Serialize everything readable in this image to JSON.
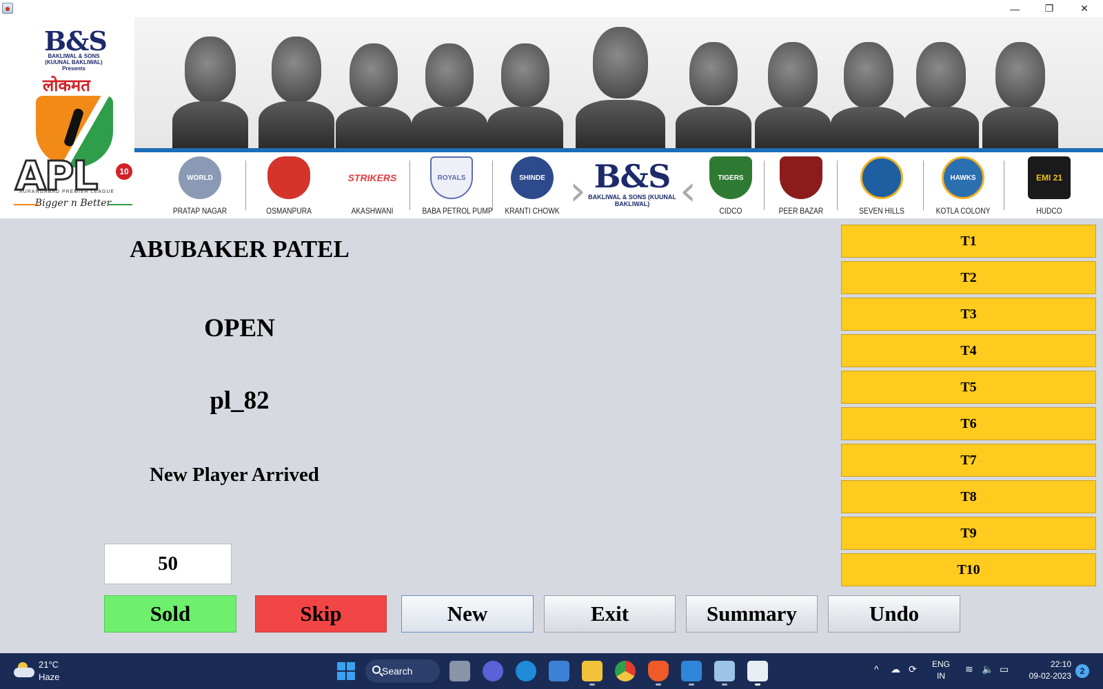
{
  "window": {
    "minimize_glyph": "—",
    "restore_glyph": "❐",
    "close_glyph": "✕"
  },
  "banner": {
    "sponsor_top": "B&S",
    "sponsor_top_sub": "BAKLIWAL & SONS (KUUNAL BAKLIWAL) Presents",
    "media_partner": "लोकमत",
    "league_short": "APL",
    "league_edition": "10",
    "league_full": "AURANGABAD PREMIER LEAGUE",
    "tagline": "Bigger n Better",
    "center_sponsor": "B&S",
    "center_sponsor_sub": "BAKLIWAL & SONS (KUUNAL BAKLIWAL)",
    "teams": [
      {
        "name": "PRATAP NAGAR",
        "logo_text": "WORLD",
        "color": "#8a9ab5"
      },
      {
        "name": "OSMANPURA",
        "logo_text": "",
        "color": "#d4342a"
      },
      {
        "name": "AKASHWANI",
        "logo_text": "STRIKERS",
        "color": "#e23b3b"
      },
      {
        "name": "BABA PETROL PUMP",
        "logo_text": "ROYALS",
        "color": "#5b6bb0"
      },
      {
        "name": "KRANTI CHOWK",
        "logo_text": "SHINDE",
        "color": "#2d4a8c"
      },
      {
        "name": "CIDCO",
        "logo_text": "TIGERS",
        "color": "#2e7a32"
      },
      {
        "name": "PEER BAZAR",
        "logo_text": "",
        "color": "#8c1c1c"
      },
      {
        "name": "SEVEN HILLS",
        "logo_text": "",
        "color": "#1d5fa0"
      },
      {
        "name": "KOTLA COLONY",
        "logo_text": "HAWKS",
        "color": "#2a6fb0"
      },
      {
        "name": "HUDCO",
        "logo_text": "EMI 21",
        "color": "#1a1a1a"
      }
    ]
  },
  "player": {
    "name": "ABUBAKER PATEL",
    "status": "OPEN",
    "id": "pl_82",
    "message": "New Player Arrived",
    "bid": "50"
  },
  "actions": {
    "sold": "Sold",
    "skip": "Skip",
    "new": "New",
    "exit": "Exit",
    "summary": "Summary",
    "undo": "Undo"
  },
  "team_buttons": [
    "T1",
    "T2",
    "T3",
    "T4",
    "T5",
    "T6",
    "T7",
    "T8",
    "T9",
    "T10"
  ],
  "taskbar": {
    "temperature": "21°C",
    "condition": "Haze",
    "search_label": "Search",
    "language_line1": "ENG",
    "language_line2": "IN",
    "time": "22:10",
    "date": "09-02-2023",
    "notification_count": "2"
  }
}
